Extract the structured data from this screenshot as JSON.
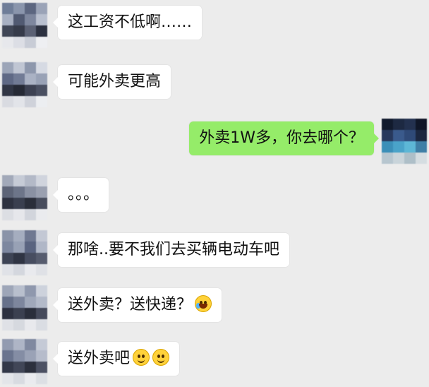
{
  "messages": [
    {
      "side": "left",
      "text": "这工资不低啊……",
      "emoji": []
    },
    {
      "side": "left",
      "text": "可能外卖更高",
      "emoji": []
    },
    {
      "side": "right",
      "text": "外卖1W多，你去哪个？",
      "emoji": []
    },
    {
      "side": "left",
      "text": "。。。",
      "emoji": []
    },
    {
      "side": "left",
      "text": "那啥..要不我们去买辆电动车吧",
      "emoji": []
    },
    {
      "side": "left",
      "text": "送外卖？送快递？",
      "emoji": [
        "laugh-cry-emoji"
      ]
    },
    {
      "side": "left",
      "text": "送外卖吧",
      "emoji": [
        "smile-emoji",
        "smile-emoji"
      ]
    }
  ],
  "colors": {
    "background": "#ececec",
    "incoming_bubble": "#ffffff",
    "outgoing_bubble": "#95ec69"
  }
}
